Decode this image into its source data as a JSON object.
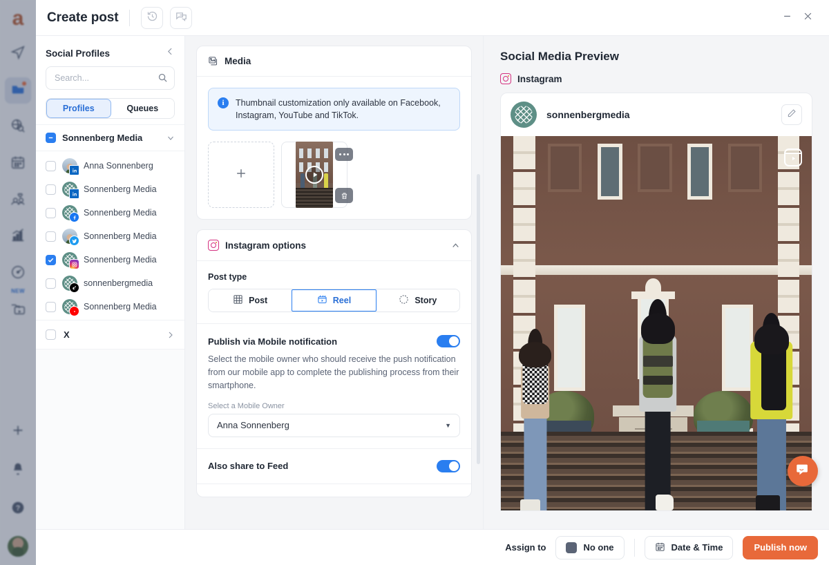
{
  "app_rail": {
    "logo": "agorapulse-logo",
    "items": [
      {
        "name": "publishing-icon",
        "label": "",
        "active": false
      },
      {
        "name": "inbox-icon",
        "label": "",
        "active": true,
        "dot": true
      },
      {
        "name": "listening-icon",
        "label": "",
        "active": false
      },
      {
        "name": "calendar-icon",
        "label": "",
        "active": false
      },
      {
        "name": "fans-icon",
        "label": "",
        "active": false
      },
      {
        "name": "reports-icon",
        "label": "",
        "active": false
      },
      {
        "name": "benchmark-icon",
        "label": "NEW",
        "active": false
      },
      {
        "name": "media-library-icon",
        "label": "",
        "active": false
      }
    ],
    "bottom_items": [
      {
        "name": "add-icon"
      },
      {
        "name": "notifications-bell-icon"
      },
      {
        "name": "help-icon"
      }
    ]
  },
  "header": {
    "title": "Create post",
    "history_icon": "history-icon",
    "comments_icon": "comments-icon",
    "minimize_icon": "minimize-icon",
    "close_icon": "close-icon"
  },
  "profiles_pane": {
    "title": "Social Profiles",
    "collapse_icon": "chevron-left-icon",
    "search": {
      "placeholder": "Search...",
      "value": "",
      "icon": "search-icon"
    },
    "tabs": [
      {
        "label": "Profiles",
        "active": true
      },
      {
        "label": "Queues",
        "active": false
      }
    ],
    "group": {
      "name": "Sonnenberg Media",
      "checkbox_state": "indeterminate",
      "expanded": true,
      "chevron": "chevron-down-icon"
    },
    "items": [
      {
        "name": "Anna Sonnenberg",
        "platform": "linkedin",
        "avatar": "person",
        "checked": false
      },
      {
        "name": "Sonnenberg Media",
        "platform": "linkedin",
        "avatar": "logo",
        "checked": false
      },
      {
        "name": "Sonnenberg Media",
        "platform": "facebook",
        "avatar": "logo",
        "checked": false
      },
      {
        "name": "Sonnenberg Media",
        "platform": "twitter",
        "avatar": "person",
        "checked": false
      },
      {
        "name": "Sonnenberg Media",
        "platform": "instagram",
        "avatar": "logo",
        "checked": true
      },
      {
        "name": "sonnenbergmedia",
        "platform": "tiktok",
        "avatar": "logo",
        "checked": false
      },
      {
        "name": "Sonnenberg Media",
        "platform": "youtube",
        "avatar": "logo",
        "checked": false
      }
    ],
    "x_group": {
      "name": "X",
      "checkbox_state": "unchecked",
      "chevron": "chevron-right-icon"
    }
  },
  "editor": {
    "media_card": {
      "title": "Media",
      "icon": "images-icon",
      "info_banner": {
        "icon": "info-icon",
        "text": "Thumbnail customization only available on Facebook, Instagram, YouTube and TikTok."
      },
      "add_button": {
        "name": "add-media-button",
        "icon": "plus-icon"
      },
      "thumbnail": {
        "play_icon": "play-icon",
        "more_icon": "more-options-icon",
        "delete_icon": "trash-icon"
      }
    },
    "instagram_card": {
      "title": "Instagram options",
      "icon": "instagram-icon",
      "collapse_icon": "chevron-up-icon",
      "post_type": {
        "label": "Post type",
        "options": [
          {
            "label": "Post",
            "icon": "grid-icon",
            "active": false
          },
          {
            "label": "Reel",
            "icon": "reel-icon",
            "active": true
          },
          {
            "label": "Story",
            "icon": "story-icon",
            "active": false
          }
        ]
      },
      "mobile_notification": {
        "label": "Publish via Mobile notification",
        "enabled": true,
        "description": "Select the mobile owner who should receive the push notification from our mobile app to complete the publishing process from their smartphone.",
        "owner_field_label": "Select a Mobile Owner",
        "owner_value": "Anna Sonnenberg",
        "caret_icon": "caret-down-icon"
      },
      "also_share_to_feed": {
        "label": "Also share to Feed",
        "enabled": true
      }
    }
  },
  "preview": {
    "title": "Social Media Preview",
    "platform": {
      "name": "Instagram",
      "icon": "instagram-icon"
    },
    "account_handle": "sonnenbergmedia",
    "edit_icon": "pencil-icon",
    "media_badge_icon": "reels-icon",
    "photo_alt": "Three students with backpacks walking up brick steps toward a university building"
  },
  "chat_widget": {
    "icon": "chat-bubble-icon",
    "color": "#e8693a"
  },
  "footer": {
    "assign_label": "Assign to",
    "assignee": "No one",
    "date_time_label": "Date & Time",
    "date_time_icon": "calendar-icon",
    "publish_label": "Publish now"
  },
  "colors": {
    "accent_blue": "#2a7ef0",
    "accent_orange": "#e8693a",
    "text_dark": "#1f2733",
    "text_muted": "#8a93a2",
    "panel_bg": "#f4f5f7",
    "border": "#e4e7ec"
  }
}
